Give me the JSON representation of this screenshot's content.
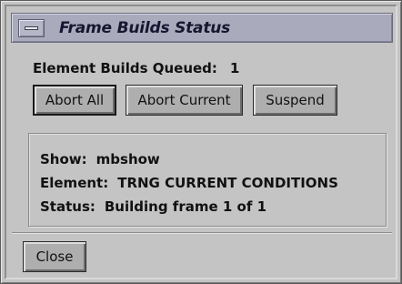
{
  "window": {
    "title": "Frame Builds Status"
  },
  "queue": {
    "label": "Element Builds Queued:",
    "count": "1"
  },
  "buttons": {
    "abort_all": "Abort All",
    "abort_current": "Abort Current",
    "suspend": "Suspend",
    "close": "Close"
  },
  "info": {
    "show_label": "Show:",
    "show_value": "mbshow",
    "element_label": "Element:",
    "element_value": "TRNG CURRENT CONDITIONS",
    "status_label": "Status:",
    "status_value": "Building frame 1 of 1"
  }
}
